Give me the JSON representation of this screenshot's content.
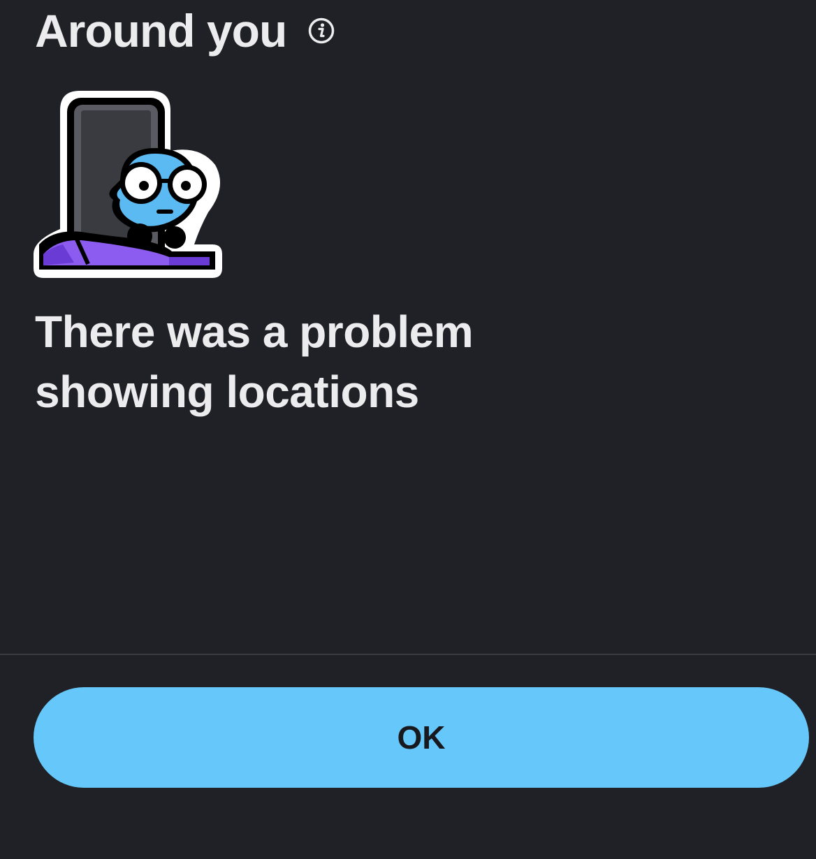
{
  "header": {
    "title": "Around you",
    "info_icon": "info-icon"
  },
  "illustration": {
    "name": "location-error-mascot"
  },
  "message": {
    "line1": "There was a problem",
    "line2": "showing locations"
  },
  "actions": {
    "ok_label": "OK"
  },
  "colors": {
    "background": "#202126",
    "text": "#ECECEE",
    "button": "#66C8FA",
    "button_text": "#17191E",
    "divider": "#3A3B40"
  }
}
